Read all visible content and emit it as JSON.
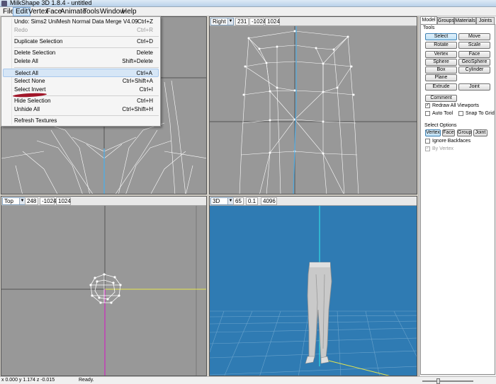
{
  "window": {
    "title": "MilkShape 3D 1.8.4 - untitled"
  },
  "menubar": {
    "items": [
      "File",
      "Edit",
      "Vertex",
      "Face",
      "Animate",
      "Tools",
      "Window",
      "Help"
    ]
  },
  "edit_menu": {
    "items": [
      {
        "label": "Undo: Sims2 UniMesh Normal Data Merge V4.09",
        "shortcut": "Ctrl+Z"
      },
      {
        "label": "Redo",
        "shortcut": "Ctrl+R"
      },
      {
        "label": "Duplicate Selection",
        "shortcut": "Ctrl+D"
      },
      {
        "label": "Delete Selection",
        "shortcut": "Delete"
      },
      {
        "label": "Delete All",
        "shortcut": "Shift+Delete"
      },
      {
        "label": "Select All",
        "shortcut": "Ctrl+A"
      },
      {
        "label": "Select None",
        "shortcut": "Ctrl+Shift+A"
      },
      {
        "label": "Select Invert",
        "shortcut": "Ctrl+I"
      },
      {
        "label": "Hide Selection",
        "shortcut": "Ctrl+H"
      },
      {
        "label": "Unhide All",
        "shortcut": "Ctrl+Shift+H"
      },
      {
        "label": "Refresh Textures",
        "shortcut": ""
      }
    ]
  },
  "viewports": {
    "right": {
      "view": "Right",
      "v1": "231",
      "v2": "-1024",
      "v3": "1024"
    },
    "top": {
      "view": "Top",
      "v1": "248",
      "v2": "-1024",
      "v3": "1024"
    },
    "3d": {
      "view": "3D",
      "v1": "65",
      "v2": "0.1",
      "v3": "4096"
    }
  },
  "panel": {
    "tabs": [
      "Model",
      "Groups",
      "Materials",
      "Joints"
    ],
    "tools_label": "Tools",
    "tools": [
      "Select",
      "Move",
      "Rotate",
      "Scale",
      "Vertex",
      "Face",
      "Sphere",
      "GeoSphere",
      "Box",
      "Cylinder",
      "Plane",
      "Extrude",
      "Joint"
    ],
    "comment": "Comment",
    "redraw": "Redraw All Viewports",
    "auto_tool": "Auto Tool",
    "snap_to_grid": "Snap To Grid",
    "select_options_label": "Select Options",
    "select_modes": [
      "Vertex",
      "Face",
      "Group",
      "Joint"
    ],
    "ignore_backfaces": "Ignore Backfaces",
    "by_vertex": "By Vertex"
  },
  "status": {
    "coords": "x 0.000 y 1.174 z -0.015",
    "state": "Ready."
  },
  "colors": {
    "viewport_gray": "#989898",
    "viewport_3d": "#2f7bb3",
    "accent_red": "#a1172a"
  }
}
